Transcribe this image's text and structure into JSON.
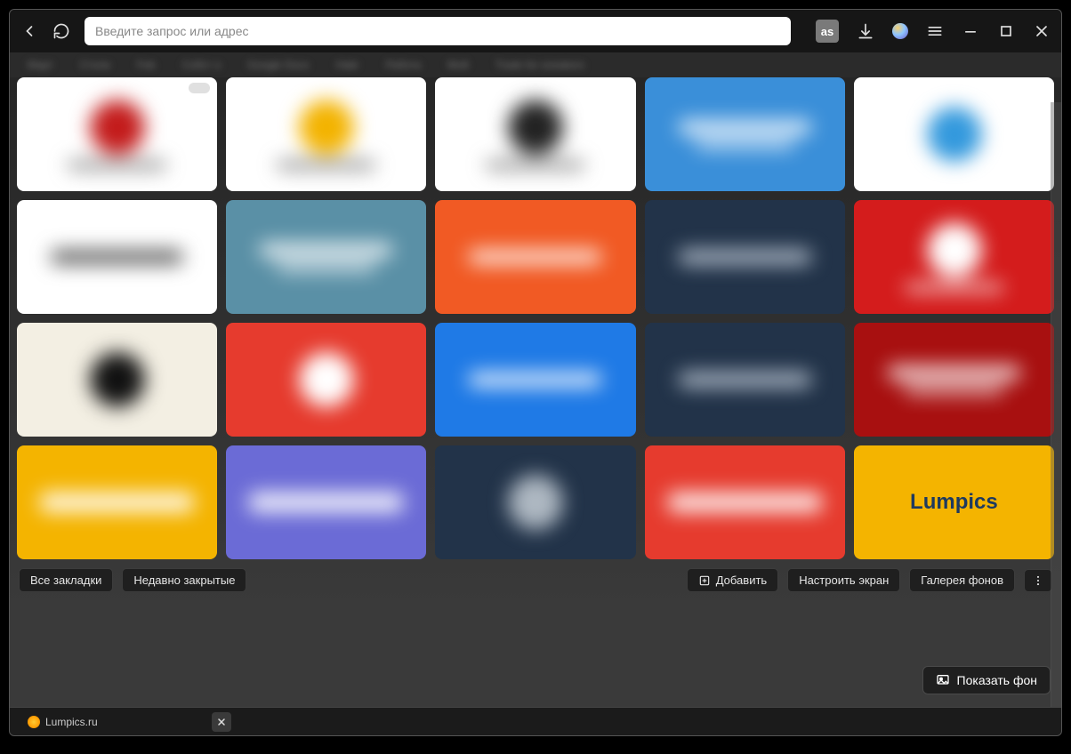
{
  "toolbar": {
    "address_placeholder": "Введите запрос или адрес",
    "lastfm_label": "as"
  },
  "bookmark_strip": [
    "Март",
    "Столи",
    "Feb",
    "Собст о",
    "Google Docs",
    "Habr",
    "Работа",
    "Мой",
    "Trade for sneakers"
  ],
  "tiles": [
    {
      "bg": "#ffffff",
      "fg": "#666666",
      "logo": "#c31b1b",
      "sub": true,
      "tag": true
    },
    {
      "bg": "#ffffff",
      "fg": "#666666",
      "logo": "#f3b300",
      "sub": true
    },
    {
      "bg": "#ffffff",
      "fg": "#666666",
      "logo": "#222222",
      "sub": true
    },
    {
      "bg": "#3a8fd9",
      "fg": "#ffffff",
      "title": true,
      "sub": true
    },
    {
      "bg": "#ffffff",
      "fg": "#666666",
      "logo": "#3399dd"
    },
    {
      "bg": "#ffffff",
      "fg": "#666666",
      "title": true,
      "title_color": "#444"
    },
    {
      "bg": "#5a90a6",
      "fg": "#ffffff",
      "title": true,
      "sub": true
    },
    {
      "bg": "#f15a24",
      "fg": "#ffffff",
      "title": true
    },
    {
      "bg": "#223349",
      "fg": "#c9d3df",
      "title": true
    },
    {
      "bg": "#d41c1c",
      "fg": "#ffffff",
      "logo": "#ffffff",
      "sub": true
    },
    {
      "bg": "#f3efe3",
      "fg": "#666666",
      "logo": "#111111"
    },
    {
      "bg": "#e63b2e",
      "fg": "#ffffff",
      "logo": "#ffffff"
    },
    {
      "bg": "#1f7ae6",
      "fg": "#ffffff",
      "title": true
    },
    {
      "bg": "#223349",
      "fg": "#c9d3df",
      "title": true
    },
    {
      "bg": "#a81010",
      "fg": "#ffffff",
      "title": true,
      "sub": true
    },
    {
      "bg": "#f4b400",
      "fg": "#ffffff",
      "title": true,
      "big_title": "Google Keep"
    },
    {
      "bg": "#6b6bd6",
      "fg": "#ffffff",
      "title": true,
      "big_title": "Plaza"
    },
    {
      "bg": "#223349",
      "fg": "#c9d3df",
      "logo": "#aeb8c2"
    },
    {
      "bg": "#e63b2e",
      "fg": "#ffffff",
      "title": true,
      "big_title": "Puzzle-movies"
    },
    {
      "bg": "#f4b400",
      "fg": "#1e3a5f",
      "clear_title": "Lumpics"
    }
  ],
  "chips": {
    "all_bookmarks": "Все закладки",
    "recently_closed": "Недавно закрытые",
    "add": "Добавить",
    "customize": "Настроить экран",
    "gallery": "Галерея фонов"
  },
  "show_bg_btn": "Показать фон",
  "taskbar": {
    "task_label": "Lumpics.ru"
  }
}
